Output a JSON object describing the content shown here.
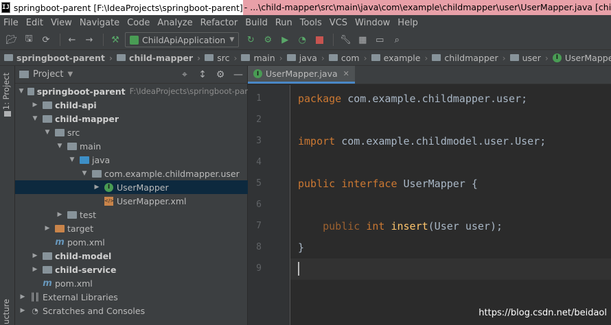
{
  "window": {
    "app_icon": "IJ",
    "title_project": "springboot-parent [F:\\IdeaProjects\\springboot-parent]",
    "title_path": " - ...\\child-mapper\\src\\main\\java\\com\\example\\childmapper\\user\\UserMapper.java [child-mapp"
  },
  "menu": [
    "File",
    "Edit",
    "View",
    "Navigate",
    "Code",
    "Analyze",
    "Refactor",
    "Build",
    "Run",
    "Tools",
    "VCS",
    "Window",
    "Help"
  ],
  "toolbar": {
    "run_config": "ChildApiApplication",
    "icons": [
      "folder-open-icon",
      "save-icon",
      "sync-icon",
      "back-icon",
      "forward-icon",
      "build-icon",
      "run-icon",
      "debug-icon",
      "coverage-icon",
      "profile-icon",
      "stop-icon",
      "settings-icon",
      "structure-icon",
      "terminal-icon",
      "search-icon"
    ]
  },
  "breadcrumbs": [
    "springboot-parent",
    "child-mapper",
    "src",
    "main",
    "java",
    "com",
    "example",
    "childmapper",
    "user",
    "UserMapper"
  ],
  "left_strip": {
    "project_tab": "1: Project",
    "structure_tab": "ucture"
  },
  "project_panel": {
    "title": "Project",
    "tree": [
      {
        "label": "springboot-parent",
        "extra": "F:\\IdeaProjects\\springboot-par",
        "level": 0,
        "expanded": true,
        "bold": true,
        "icon": "module-folder"
      },
      {
        "label": "child-api",
        "level": 1,
        "expanded": false,
        "bold": true,
        "icon": "module-folder"
      },
      {
        "label": "child-mapper",
        "level": 1,
        "expanded": true,
        "bold": true,
        "icon": "module-folder"
      },
      {
        "label": "src",
        "level": 2,
        "expanded": true,
        "icon": "folder"
      },
      {
        "label": "main",
        "level": 3,
        "expanded": true,
        "icon": "folder"
      },
      {
        "label": "java",
        "level": 4,
        "expanded": true,
        "icon": "source-folder"
      },
      {
        "label": "com.example.childmapper.user",
        "level": 5,
        "expanded": true,
        "icon": "package"
      },
      {
        "label": "UserMapper",
        "level": 6,
        "expanded": false,
        "icon": "interface",
        "selected": true
      },
      {
        "label": "UserMapper.xml",
        "level": 6,
        "icon": "xml-file"
      },
      {
        "label": "test",
        "level": 3,
        "expanded": false,
        "icon": "folder"
      },
      {
        "label": "target",
        "level": 2,
        "expanded": false,
        "icon": "excluded-folder"
      },
      {
        "label": "pom.xml",
        "level": 2,
        "icon": "maven-file"
      },
      {
        "label": "child-model",
        "level": 1,
        "expanded": false,
        "bold": true,
        "icon": "module-folder"
      },
      {
        "label": "child-service",
        "level": 1,
        "expanded": false,
        "bold": true,
        "icon": "module-folder"
      },
      {
        "label": "pom.xml",
        "level": 1,
        "icon": "maven-file"
      },
      {
        "label": "External Libraries",
        "level": 0,
        "expanded": false,
        "icon": "library"
      },
      {
        "label": "Scratches and Consoles",
        "level": 0,
        "expanded": false,
        "icon": "scratches"
      }
    ]
  },
  "editor": {
    "tab_label": "UserMapper.java",
    "line_numbers": [
      "1",
      "2",
      "3",
      "4",
      "5",
      "6",
      "7",
      "8",
      "9"
    ],
    "lines": [
      [
        {
          "t": "package",
          "c": "kw"
        },
        {
          "t": " com.example.childmapper.user;",
          "c": ""
        }
      ],
      [],
      [
        {
          "t": "import",
          "c": "kw"
        },
        {
          "t": " com.example.childmodel.user.User;",
          "c": ""
        }
      ],
      [],
      [
        {
          "t": "public",
          "c": "kw"
        },
        {
          "t": " ",
          "c": ""
        },
        {
          "t": "interface",
          "c": "kw"
        },
        {
          "t": " UserMapper {",
          "c": ""
        }
      ],
      [],
      [
        {
          "t": "    public",
          "c": "kwd"
        },
        {
          "t": " ",
          "c": ""
        },
        {
          "t": "int",
          "c": "kw"
        },
        {
          "t": " ",
          "c": ""
        },
        {
          "t": "insert",
          "c": "mt"
        },
        {
          "t": "(User user);",
          "c": ""
        }
      ],
      [
        {
          "t": "}",
          "c": ""
        }
      ],
      []
    ],
    "current_line": 9
  },
  "watermark": "https://blog.csdn.net/beidaol"
}
